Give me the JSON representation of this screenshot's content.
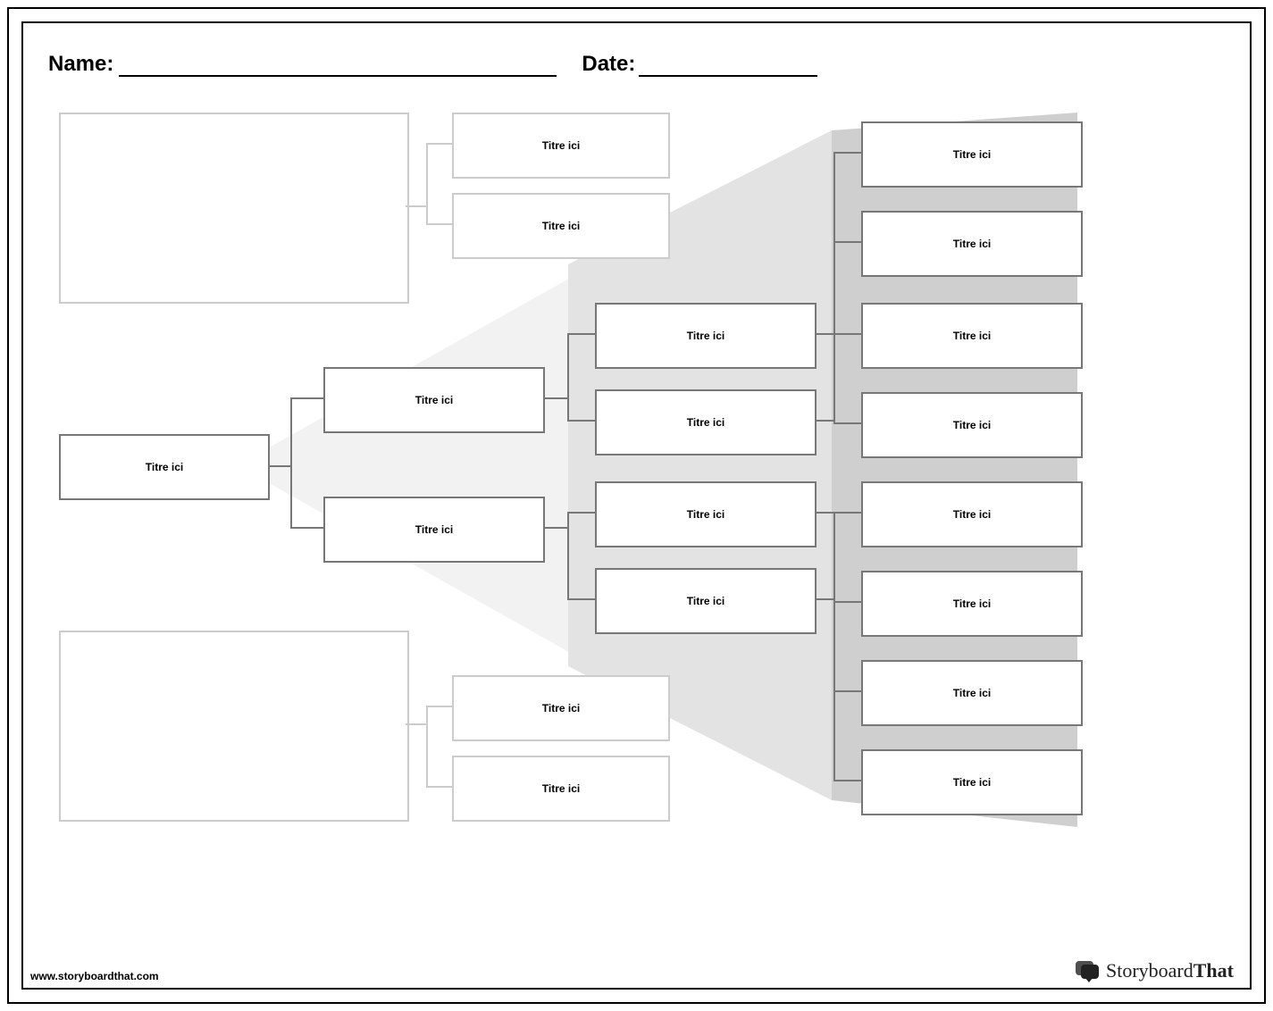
{
  "header": {
    "name_label": "Name:",
    "date_label": "Date:"
  },
  "placeholder": "Titre ici",
  "footer": "www.storyboardthat.com",
  "brand": {
    "a": "Storyboard",
    "b": "That"
  },
  "tree": {
    "root": "Titre ici",
    "level2": [
      "Titre ici",
      "Titre ici"
    ],
    "level3": [
      "Titre ici",
      "Titre ici",
      "Titre ici",
      "Titre ici"
    ],
    "level4": [
      "Titre ici",
      "Titre ici",
      "Titre ici",
      "Titre ici",
      "Titre ici",
      "Titre ici",
      "Titre ici",
      "Titre ici"
    ]
  },
  "side_boxes": {
    "top": [
      "Titre ici",
      "Titre ici"
    ],
    "bottom": [
      "Titre ici",
      "Titre ici"
    ]
  }
}
